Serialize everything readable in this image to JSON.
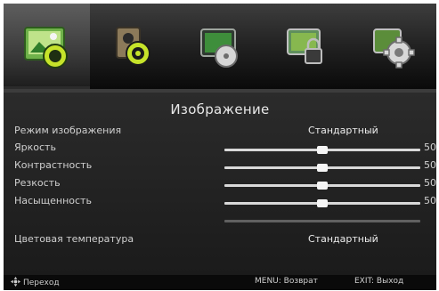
{
  "tabs": [
    {
      "icon": "picture-icon",
      "active": true
    },
    {
      "icon": "sound-icon",
      "active": false
    },
    {
      "icon": "channel-icon",
      "active": false
    },
    {
      "icon": "lock-icon",
      "active": false
    },
    {
      "icon": "settings-gear-icon",
      "active": false
    }
  ],
  "menu": {
    "title": "Изображение",
    "picture_mode_label": "Режим изображения",
    "picture_mode_value": "Стандартный",
    "sliders": [
      {
        "label": "Яркость",
        "value": 50
      },
      {
        "label": "Контрастность",
        "value": 50
      },
      {
        "label": "Резкость",
        "value": 50
      },
      {
        "label": "Насыщенность",
        "value": 50
      }
    ],
    "color_temp_label": "Цветовая температура",
    "color_temp_value": "Стандартный"
  },
  "footer": {
    "nav": "Переход",
    "menu": "MENU: Возврат",
    "exit": "EXIT: Выход"
  },
  "colors": {
    "accent": "#c6e32a",
    "background": "#1b1b1b"
  }
}
